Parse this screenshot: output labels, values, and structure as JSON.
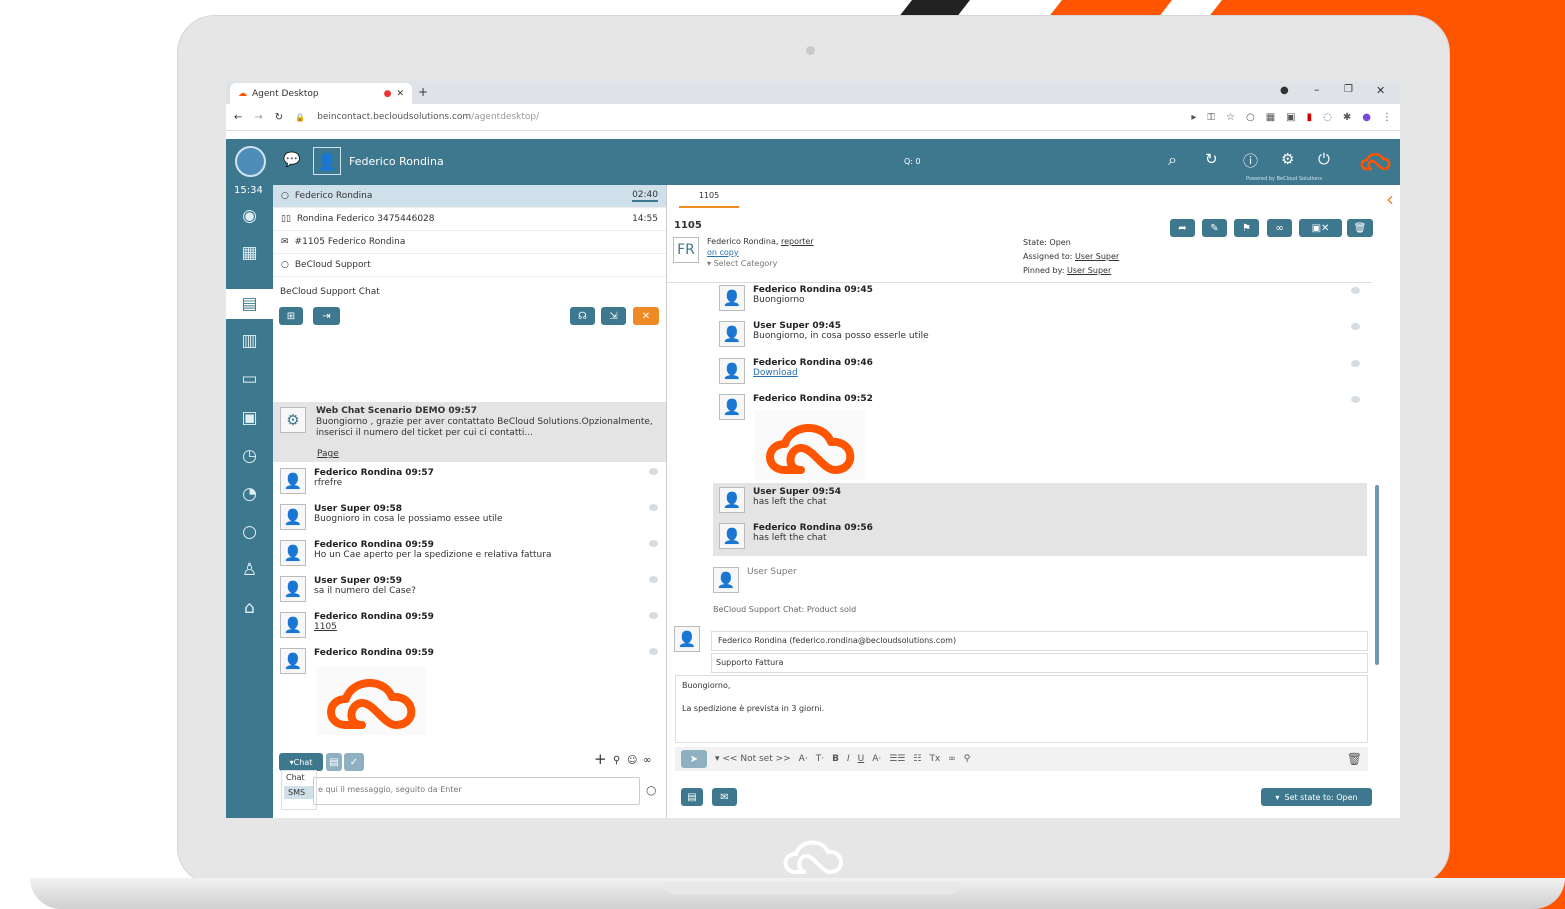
{
  "browser": {
    "tab_title": "Agent Desktop",
    "url_domain": "beincontact.becloudsolutions.com",
    "url_path": "/agentdesktop/"
  },
  "header": {
    "agent_name": "Federico Rondina",
    "queue": "Q: 0",
    "powered": "Powered by BeCloud Solutions"
  },
  "sidebar": {
    "clock": "15:34"
  },
  "conversations": [
    {
      "icon": "chat-bubble-icon",
      "label": "Federico Rondina",
      "time": "02:40",
      "active": true
    },
    {
      "icon": "phone-icon",
      "label": "Rondina Federico  3475446028",
      "time": "14:55"
    },
    {
      "icon": "mail-icon",
      "label": "#1105 Federico Rondina",
      "time": ""
    },
    {
      "icon": "chat-bubble-icon",
      "label": "BeCloud Support",
      "time": ""
    }
  ],
  "chat": {
    "title": "BeCloud Support Chat",
    "system_msg": {
      "header": "Web Chat Scenario DEMO 09:57",
      "line1": "Buongiorno , grazie per aver contattato BeCloud Solutions.Opzionalmente,",
      "line2": "inserisci il numero del ticket per cui ci contatti...",
      "link": "Page"
    },
    "messages": [
      {
        "header": "Federico Rondina 09:57",
        "text": "rfrefre"
      },
      {
        "header": "User Super 09:58",
        "text": "Buognioro in cosa le possiamo essee utile"
      },
      {
        "header": "Federico Rondina 09:59",
        "text": "Ho un Cae aperto per la spedizione e relativa fattura"
      },
      {
        "header": "User Super 09:59",
        "text": "sa il numero del Case?"
      },
      {
        "header": "Federico Rondina 09:59",
        "text": "1105"
      },
      {
        "header": "Federico Rondina 09:59",
        "text": ""
      }
    ],
    "channel_selected": "Chat",
    "channel_options": [
      "Chat",
      "SMS"
    ],
    "input_placeholder": "e qui il messaggio, seguito da Enter"
  },
  "ticket": {
    "tab": "1105",
    "number": "1105",
    "initials": "FR",
    "reporter": "Federico Rondina,",
    "reporter_role": "reporter",
    "on_copy": "on copy",
    "category": "Select Category",
    "state": "State: Open",
    "assigned_label": "Assigned to:",
    "assigned": "User Super",
    "pinned_label": "Pinned by:",
    "pinned": "User Super",
    "messages": [
      {
        "header": "Federico Rondina 09:45",
        "text": "Buongiorno"
      },
      {
        "header": "User Super 09:45",
        "text": "Buongiorno, in cosa posso esserle utile"
      },
      {
        "header": "Federico Rondina 09:46",
        "text": "Download"
      },
      {
        "header": "Federico Rondina 09:52",
        "text": ""
      },
      {
        "header": "User Super 09:54",
        "text": "has left the chat"
      },
      {
        "header": "Federico Rondina 09:56",
        "text": "has left the chat"
      }
    ],
    "user_super": "User Super",
    "chat_note": "BeCloud Support Chat: Product sold",
    "email_to": "Federico Rondina (federico.rondina@becloudsolutions.com)",
    "subject": "Supporto Fattura",
    "body1": "Buongiorno,",
    "body2": "La spedizione è prevista in 3 giorni.",
    "format_label": "<< Not set >>",
    "set_state": "Set state to: Open"
  },
  "colors": {
    "brand": "#3e788e",
    "accent": "#ff5400",
    "highlight": "#f08a24"
  }
}
